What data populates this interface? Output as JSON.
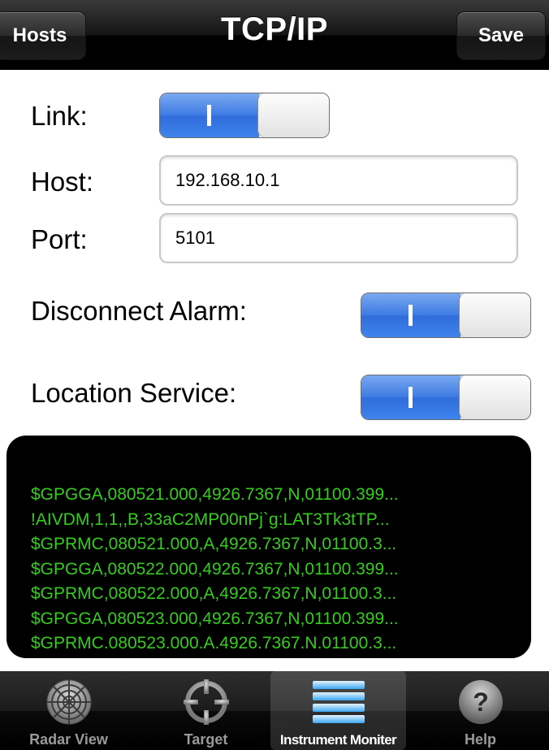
{
  "nav": {
    "title": "TCP/IP",
    "left_button": "Hosts",
    "right_button": "Save"
  },
  "form": {
    "link_label": "Link:",
    "link_on": true,
    "host_label": "Host:",
    "host_value": "192.168.10.1",
    "port_label": "Port:",
    "port_value": "5101",
    "disconnect_alarm_label": "Disconnect Alarm:",
    "disconnect_alarm_on": true,
    "location_service_label": "Location Service:",
    "location_service_on": true
  },
  "monitor": {
    "lines": [
      "$GPGGA,080521.000,4926.7367,N,01100.399...",
      "!AIVDM,1,1,,B,33aC2MP00nPj`g:LAT3Tk3tTP...",
      "$GPRMC,080521.000,A,4926.7367,N,01100.3...",
      "$GPGGA,080522.000,4926.7367,N,01100.399...",
      "$GPRMC,080522.000,A,4926.7367,N,01100.3...",
      "$GPGGA,080523.000,4926.7367,N,01100.399...",
      "$GPRMC.080523.000.A.4926.7367.N.01100.3..."
    ],
    "text_color": "#36cc1e"
  },
  "tabs": [
    {
      "label": "Radar View",
      "icon": "radar-icon",
      "active": false
    },
    {
      "label": "Target",
      "icon": "crosshair-icon",
      "active": false
    },
    {
      "label": "Instrument Moniter",
      "icon": "instrument-monitor-icon",
      "active": true
    },
    {
      "label": "Help",
      "icon": "help-icon",
      "active": false
    }
  ],
  "colors": {
    "switch_on": "#3d7ae3",
    "bar_bg": "#000000"
  }
}
